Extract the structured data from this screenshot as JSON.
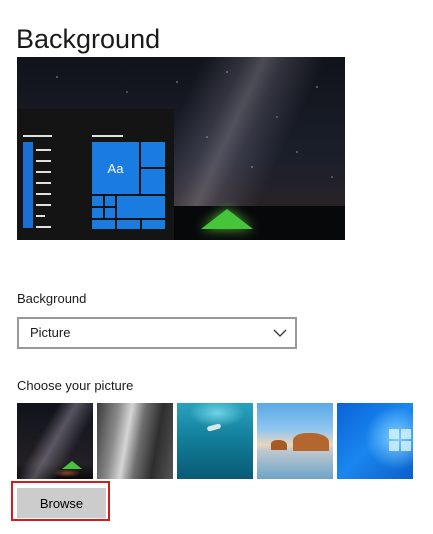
{
  "page": {
    "title": "Background"
  },
  "preview": {
    "tile_label": "Aa"
  },
  "background_field": {
    "label": "Background",
    "selected": "Picture"
  },
  "picture_chooser": {
    "label": "Choose your picture",
    "thumbnails": [
      {
        "icon": "night-sky-tent-thumbnail"
      },
      {
        "icon": "rock-cliff-thumbnail"
      },
      {
        "icon": "underwater-swimmer-thumbnail"
      },
      {
        "icon": "beach-rocks-thumbnail"
      },
      {
        "icon": "windows-logo-thumbnail"
      }
    ]
  },
  "actions": {
    "browse_label": "Browse"
  },
  "colors": {
    "accent": "#1a7be0",
    "highlight": "#d41c1c",
    "button_bg": "#cccccc"
  }
}
